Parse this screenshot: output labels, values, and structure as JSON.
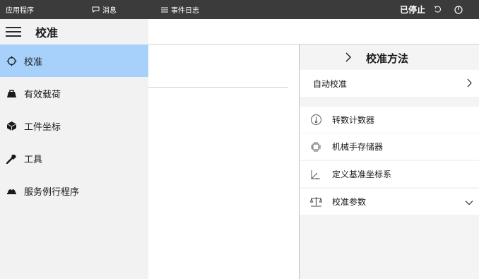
{
  "topbar": {
    "app_label": "应用程序",
    "messages_label": "消息",
    "events_label": "事件日志",
    "status_label": "已停止"
  },
  "title": {
    "page_title": "校准"
  },
  "sidebar": {
    "items": [
      {
        "label": "校准",
        "icon": "crosshair-icon",
        "active": true
      },
      {
        "label": "有效载荷",
        "icon": "payload-icon",
        "active": false
      },
      {
        "label": "工件坐标",
        "icon": "workobject-icon",
        "active": false
      },
      {
        "label": "工具",
        "icon": "tool-icon",
        "active": false
      },
      {
        "label": "服务例行程序",
        "icon": "service-routine-icon",
        "active": false
      }
    ]
  },
  "right_panel": {
    "title": "校准方法",
    "auto_label": "自动校准",
    "items": [
      {
        "label": "转数计数器",
        "icon": "revolution-counter-icon"
      },
      {
        "label": "机械手存储器",
        "icon": "robot-memory-icon"
      },
      {
        "label": "定义基准坐标系",
        "icon": "base-frame-icon"
      },
      {
        "label": "校准参数",
        "icon": "balance-icon"
      }
    ]
  },
  "colors": {
    "topbar_bg": "#3b3b3b",
    "sidebar_bg": "#f2f2f2",
    "active_item_bg": "#a7d1fb",
    "panel_bg": "#f4f4f4"
  }
}
